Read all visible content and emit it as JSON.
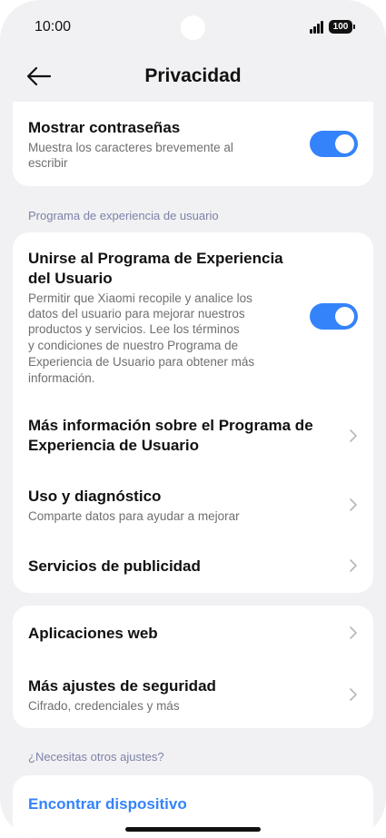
{
  "status_bar": {
    "time": "10:00",
    "battery": "100"
  },
  "header": {
    "title": "Privacidad"
  },
  "card_passwords": {
    "title": "Mostrar contraseñas",
    "subtitle_line1": "Muestra los caracteres brevemente al",
    "subtitle_line2": "escribir",
    "toggle_on": true
  },
  "section_user_experience": {
    "label": "Programa de experiencia de usuario"
  },
  "card_user_experience": {
    "join": {
      "title_line1": "Unirse al Programa de Experiencia",
      "title_line2": "del Usuario",
      "desc_lines": [
        "Permitir que Xiaomi recopile y analice los",
        "datos del usuario para mejorar nuestros",
        "productos y servicios. Lee los términos",
        "y condiciones de nuestro Programa de",
        "Experiencia de Usuario para obtener más",
        "información."
      ],
      "toggle_on": true
    },
    "more_info": {
      "title_line1": "Más información sobre el Programa de",
      "title_line2": "Experiencia de Usuario"
    },
    "diagnostics": {
      "title": "Uso y diagnóstico",
      "subtitle": "Comparte datos para ayudar a mejorar"
    },
    "ads": {
      "title": "Servicios de publicidad"
    }
  },
  "card_security": {
    "web_apps": {
      "title": "Aplicaciones web"
    },
    "more_security": {
      "title": "Más ajustes de seguridad",
      "subtitle": "Cifrado, credenciales y más"
    }
  },
  "section_other": {
    "label": "¿Necesitas otros ajustes?"
  },
  "card_other": {
    "find_device": {
      "title": "Encontrar dispositivo"
    }
  },
  "colors": {
    "accent": "#3483fa",
    "background": "#f1f1f3",
    "card": "#ffffff",
    "section_label": "#7d82a8"
  }
}
